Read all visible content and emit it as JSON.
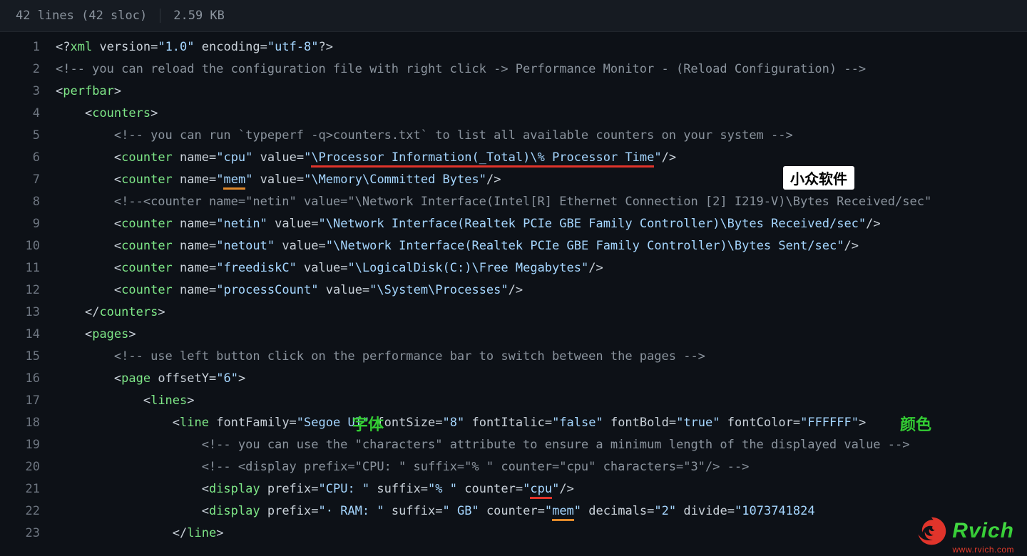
{
  "header": {
    "lines": "42 lines (42 sloc)",
    "size": "2.59 KB"
  },
  "annotations": {
    "box1": "小众软件",
    "green1": "字体",
    "green2": "颜色"
  },
  "logo": {
    "name": "Rvich",
    "url": "www.rvich.com"
  },
  "gutter": [
    "1",
    "2",
    "3",
    "4",
    "5",
    "6",
    "7",
    "8",
    "9",
    "10",
    "11",
    "12",
    "13",
    "14",
    "15",
    "16",
    "17",
    "18",
    "19",
    "20",
    "21",
    "22",
    "23"
  ],
  "code": {
    "l1": {
      "a": "<?",
      "b": "xml",
      "c": " version=",
      "d": "\"1.0\"",
      "e": " encoding=",
      "f": "\"utf-8\"",
      "g": "?>"
    },
    "l2": "<!-- you can reload the configuration file with right click -> Performance Monitor - (Reload Configuration) -->",
    "l3": {
      "a": "<",
      "b": "perfbar",
      "c": ">"
    },
    "l4": {
      "a": "<",
      "b": "counters",
      "c": ">"
    },
    "l5": "<!-- you can run `typeperf -q>counters.txt` to list all available counters on your system -->",
    "l6": {
      "a": "<",
      "b": "counter",
      "c": " name=",
      "d": "\"cpu\"",
      "e": " value=",
      "f": "\"",
      "g": "\\Processor Information(_Total)\\% Processor Time",
      "h": "\"",
      "i": "/>"
    },
    "l7": {
      "a": "<",
      "b": "counter",
      "c": " name=",
      "d": "\"",
      "e": "mem",
      "f": "\"",
      "g": " value=",
      "h": "\"\\Memory\\Committed Bytes\"",
      "i": "/>"
    },
    "l8": "<!--<counter name=\"netin\" value=\"\\Network Interface(Intel[R] Ethernet Connection [2] I219-V)\\Bytes Received/sec\"",
    "l9": {
      "a": "<",
      "b": "counter",
      "c": " name=",
      "d": "\"netin\"",
      "e": " value=",
      "f": "\"\\Network Interface(Realtek PCIe GBE Family Controller)\\Bytes Received/sec\"",
      "g": "/>"
    },
    "l10": {
      "a": "<",
      "b": "counter",
      "c": " name=",
      "d": "\"netout\"",
      "e": " value=",
      "f": "\"\\Network Interface(Realtek PCIe GBE Family Controller)\\Bytes Sent/sec\"",
      "g": "/>"
    },
    "l11": {
      "a": "<",
      "b": "counter",
      "c": " name=",
      "d": "\"freediskC\"",
      "e": " value=",
      "f": "\"\\LogicalDisk(C:)\\Free Megabytes\"",
      "g": "/>"
    },
    "l12": {
      "a": "<",
      "b": "counter",
      "c": " name=",
      "d": "\"processCount\"",
      "e": " value=",
      "f": "\"\\System\\Processes\"",
      "g": "/>"
    },
    "l13": {
      "a": "</",
      "b": "counters",
      "c": ">"
    },
    "l14": {
      "a": "<",
      "b": "pages",
      "c": ">"
    },
    "l15": "<!-- use left button click on the performance bar to switch between the pages -->",
    "l16": {
      "a": "<",
      "b": "page",
      "c": " offsetY=",
      "d": "\"6\"",
      "e": ">"
    },
    "l17": {
      "a": "<",
      "b": "lines",
      "c": ">"
    },
    "l18": {
      "a": "<",
      "b": "line",
      "c": " fontFamily=",
      "d": "\"Segoe UI\"",
      "e": " fontSize=",
      "f": "\"8\"",
      "g": " fontItalic=",
      "h": "\"false\"",
      "i": " fontBold=",
      "j": "\"true\"",
      "k": " fontColor=",
      "l": "\"FFFFFF\"",
      "m": ">"
    },
    "l19": "<!-- you can use the \"characters\" attribute to ensure a minimum length of the displayed value -->",
    "l20": "<!-- <display prefix=\"CPU: \" suffix=\"% \" counter=\"cpu\" characters=\"3\"/> -->",
    "l21": {
      "a": "<",
      "b": "display",
      "c": " prefix=",
      "d": "\"CPU: \"",
      "e": " suffix=",
      "f": "\"% \"",
      "g": " counter=",
      "h": "\"",
      "i": "cpu",
      "j": "\"",
      "k": "/>"
    },
    "l22": {
      "a": "<",
      "b": "display",
      "c": " prefix=",
      "d": "\"· RAM: \"",
      "e": " suffix=",
      "f": "\" GB\"",
      "g": " counter=",
      "h": "\"",
      "i": "mem",
      "j": "\"",
      "k": " decimals=",
      "l": "\"2\"",
      "m": " divide=",
      "n": "\"1073741824",
      "o": "/>"
    },
    "l23": {
      "a": "</",
      "b": "line",
      "c": ">"
    }
  },
  "indent": {
    "i0": "",
    "i1": "    ",
    "i2": "        ",
    "i3": "            ",
    "i4": "                ",
    "i5": "                    "
  }
}
